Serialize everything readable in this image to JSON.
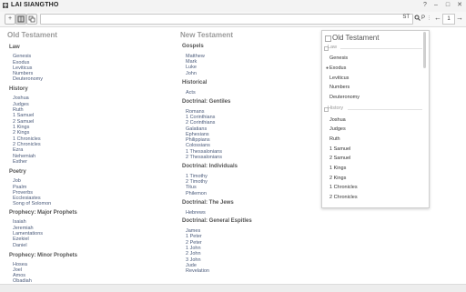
{
  "app": {
    "title": "LAI SIANGTHO",
    "window_controls": [
      "?",
      "–",
      "□",
      "✕"
    ]
  },
  "toolbar": {
    "reference": "ST",
    "page": "1"
  },
  "old_testament": {
    "title": "Old Testament",
    "groups": [
      {
        "label": "Law",
        "books": [
          "Genesis",
          "Exodus",
          "Leviticus",
          "Numbers",
          "Deuteronomy"
        ]
      },
      {
        "label": "History",
        "books": [
          "Joshua",
          "Judges",
          "Ruth",
          "1 Samuel",
          "2 Samuel",
          "1 Kings",
          "2 Kings",
          "1 Chronicles",
          "2 Chronicles",
          "Ezra",
          "Nehemiah",
          "Esther"
        ]
      },
      {
        "label": "Poetry",
        "books": [
          "Job",
          "Psalm",
          "Proverbs",
          "Ecclesiastes",
          "Song of Solomon"
        ]
      },
      {
        "label": "Prophecy: Major Prophets",
        "books": [
          "Isaiah",
          "Jeremiah",
          "Lamentations",
          "Ezekiel",
          "Daniel"
        ]
      },
      {
        "label": "Prophecy: Minor Prophets",
        "books": [
          "Hosea",
          "Joel",
          "Amos",
          "Obadiah"
        ]
      }
    ]
  },
  "new_testament": {
    "title": "New Testament",
    "groups": [
      {
        "label": "Gospels",
        "books": [
          "Matthew",
          "Mark",
          "Luke",
          "John"
        ]
      },
      {
        "label": "Historical",
        "books": [
          "Acts"
        ]
      },
      {
        "label": "Doctrinal: Gentiles",
        "books": [
          "Romans",
          "1 Corinthians",
          "2 Corinthians",
          "Galatians",
          "Ephesians",
          "Philippians",
          "Colossians",
          "1 Thessalonians",
          "2 Thessalonians"
        ]
      },
      {
        "label": "Doctrinal: Individuals",
        "books": [
          "1 Timothy",
          "2 Timothy",
          "Titus",
          "Philemon"
        ]
      },
      {
        "label": "Doctrinal: The Jews",
        "books": [
          "Hebrews"
        ]
      },
      {
        "label": "Doctrinal: General Espitles",
        "books": [
          "James",
          "1 Peter",
          "2 Peter",
          "1 John",
          "2 John",
          "3 John",
          "Jude",
          "Revelation"
        ]
      }
    ]
  },
  "popup": {
    "title": "Old Testament",
    "sections": [
      {
        "label": "Law",
        "items": [
          "Genesis",
          "Exodus",
          "Leviticus",
          "Numbers",
          "Deuteronomy"
        ],
        "selected": "Exodus"
      },
      {
        "label": "History",
        "items": [
          "Joshua",
          "Judges",
          "Ruth",
          "1 Samuel",
          "2 Samuel",
          "1 Kings",
          "2 Kings",
          "1 Chronicles",
          "2 Chronicles"
        ]
      }
    ]
  }
}
